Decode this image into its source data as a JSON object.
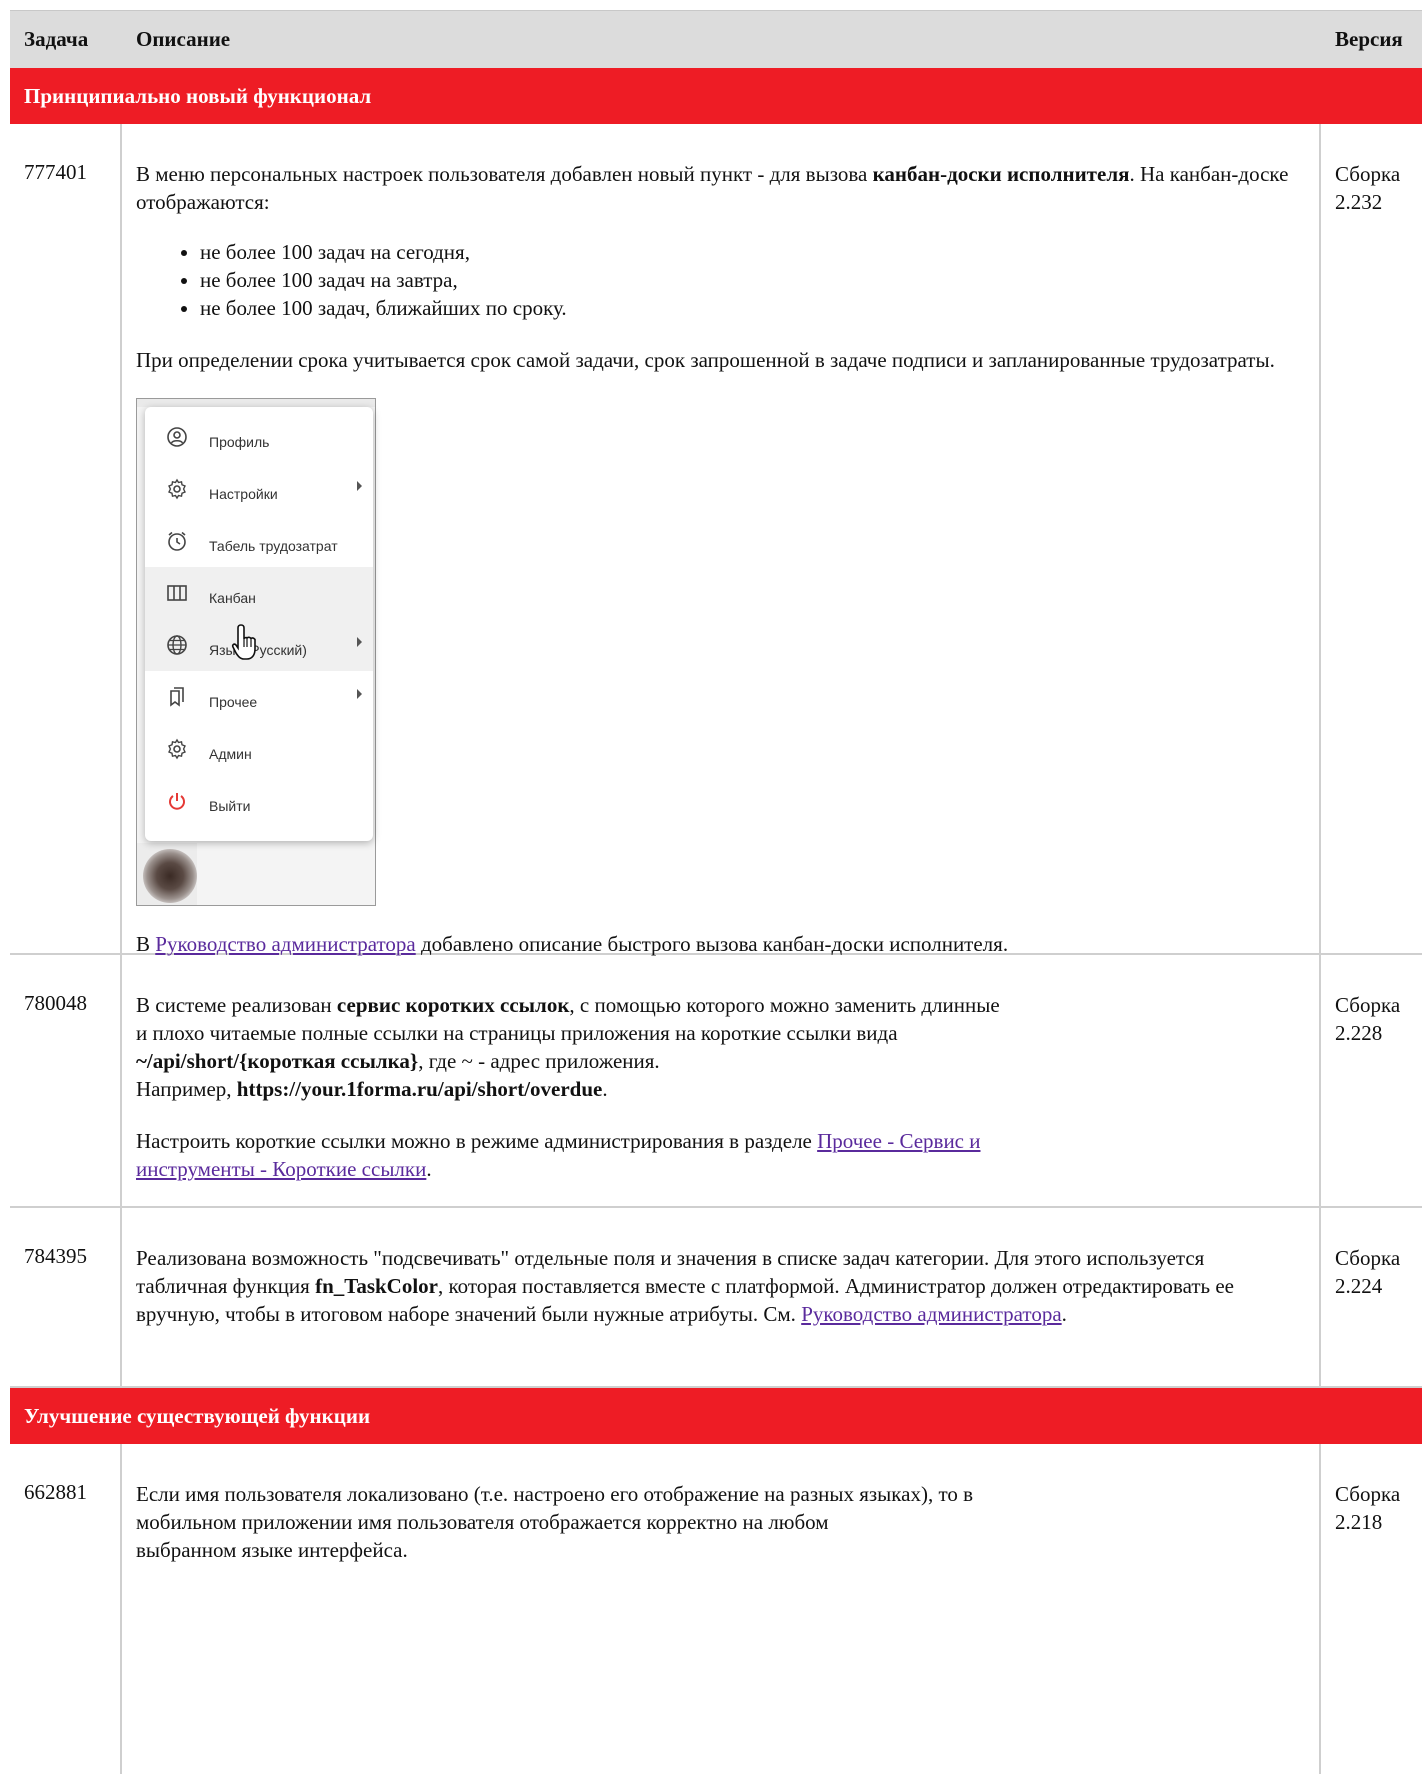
{
  "header": {
    "col_task": "Задача",
    "col_desc": "Описание",
    "col_version": "Версия"
  },
  "sections": [
    {
      "title": "Принципиально новый функционал"
    },
    {
      "title": "Улучшение существующей функции"
    }
  ],
  "rows": [
    {
      "task": "777401",
      "p1_a": "В меню персональных настроек пользователя добавлен новый пункт - для вызова ",
      "p1_b": "канбан-доски исполнителя",
      "p1_c": ". На канбан-доске отображаются:",
      "bullets": [
        "не более 100 задач на сегодня,",
        "не более 100 задач на завтра,",
        "не более 100 задач, ближайших по сроку."
      ],
      "p2": "При определении срока учитывается срок самой задачи, срок запрошенной в задаче подписи и запланированные трудозатраты.",
      "p3_a": "В ",
      "p3_link": "Руководство администратора",
      "p3_b": " добавлено описание быстрого вызова канбан-доски исполнителя.",
      "version": "Сборка 2.232",
      "menu": [
        {
          "label": "Профиль",
          "icon": "profile-icon"
        },
        {
          "label": "Настройки",
          "icon": "gear-icon"
        },
        {
          "label": "Табель трудозатрат",
          "icon": "alarm-clock-icon"
        },
        {
          "label": "Канбан",
          "icon": "kanban-icon"
        },
        {
          "label": "Язык (Русский)",
          "icon": "globe-icon"
        },
        {
          "label": "Прочее",
          "icon": "bookmarks-icon"
        },
        {
          "label": "Админ",
          "icon": "gear-icon"
        },
        {
          "label": "Выйти",
          "icon": "power-icon"
        }
      ]
    },
    {
      "task": "780048",
      "l1_a": "В системе реализован ",
      "l1_b": "сервис коротких ссылок",
      "l1_c": ", с помощью которого можно заменить длинные",
      "l2": "и плохо читаемые полные ссылки на страницы приложения на короткие ссылки вида",
      "l3_a": "~/api/short/{короткая ссылка}",
      "l3_b": ", где ~ - адрес приложения.",
      "l4_a": "Например, ",
      "l4_b": "https://your.1forma.ru/api/short/overdue",
      "l4_c": ".",
      "p2_a": "Настроить короткие ссылки можно в режиме администрирования в разделе ",
      "p2_link": "Прочее - Сервис и инструменты - Короткие ссылки",
      "p2_b": ".",
      "version": "Сборка 2.228"
    },
    {
      "task": "784395",
      "a": "Реализована возможность \"подсвечивать\" отдельные поля и значения в списке задач категории. Для этого используется табличная функция ",
      "b": "fn_TaskColor",
      "c": ", которая поставляется вместе с платформой. Администратор должен отредактировать ее вручную, чтобы в итоговом наборе значений были нужные атрибуты. См. ",
      "link": "Руководство администратора",
      "d": ".",
      "version": "Сборка 2.224"
    },
    {
      "task": "662881",
      "l1": "Если имя пользователя локализовано (т.е. настроено его отображение на разных языках), то в",
      "l2": "мобильном приложении имя пользователя отображается корректно на любом",
      "l3": "выбранном языке интерфейса.",
      "version": "Сборка 2.218"
    }
  ]
}
